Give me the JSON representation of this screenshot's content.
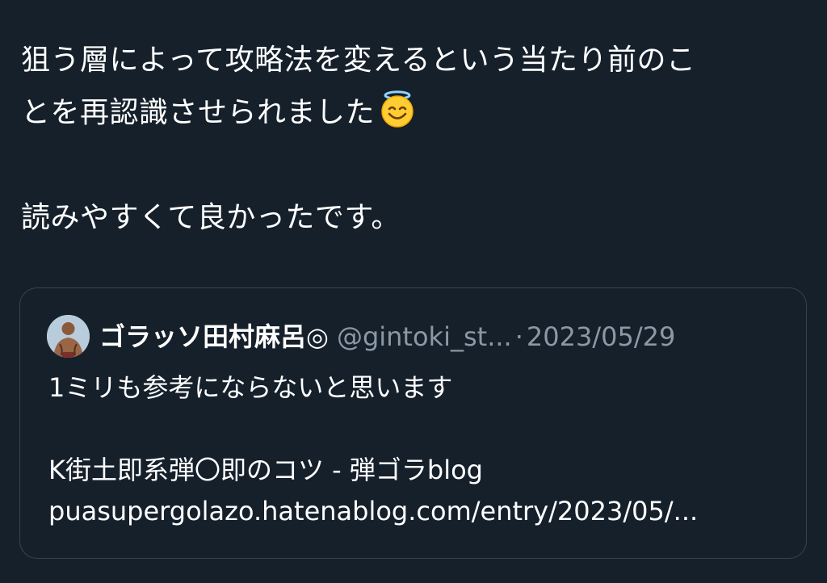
{
  "tweet": {
    "text_line1": "狙う層によって攻略法を変えるという当たり前のこ",
    "text_line2": "とを再認識させられました",
    "emoji": "smiling-face-with-halo",
    "text_line3": "読みやすくて良かったです。"
  },
  "quoted_tweet": {
    "author_name": "ゴラッソ田村麻呂◎",
    "author_handle": "@gintoki_st...",
    "separator": "·",
    "date": "2023/05/29",
    "text_line1": "1ミリも参考にならないと思います",
    "link_title": "K街土即系弾〇即のコツ - 弾ゴラblog",
    "link_url": "puasupergolazo.hatenablog.com/entry/2023/05/..."
  },
  "colors": {
    "background": "#15202b",
    "text_primary": "#ffffff",
    "text_secondary": "#8b98a5",
    "card_border": "#38444d"
  }
}
